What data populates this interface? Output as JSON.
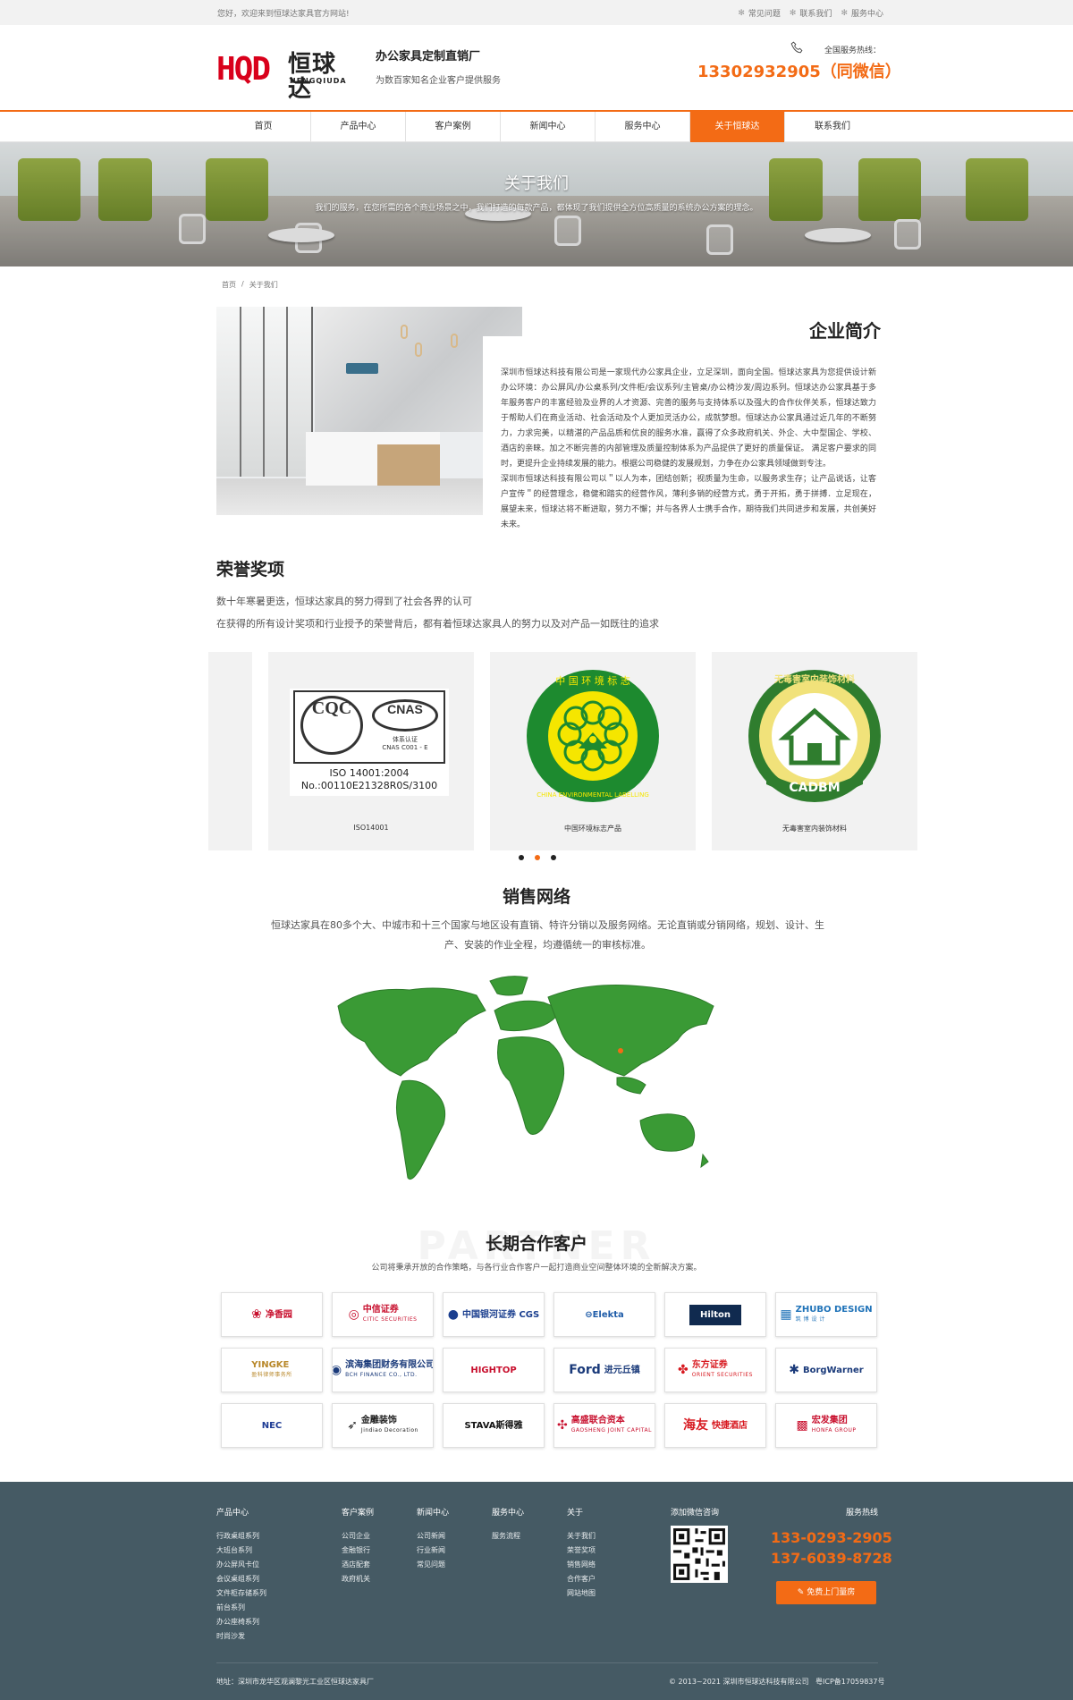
{
  "topbar": {
    "welcome": "您好，欢迎来到恒球达家具官方网站!",
    "links": [
      "常见问题",
      "联系我们",
      "服务中心"
    ]
  },
  "header": {
    "logo_text": "HQD",
    "logo_cn": "恒球达",
    "logo_en": "HENGQIUDA",
    "slogan_title": "办公家具定制直销厂",
    "slogan_sub": "为数百家知名企业客户提供服务",
    "hotline_label": "全国服务热线：",
    "hotline_number": "13302932905（同微信）"
  },
  "nav": {
    "items": [
      "首页",
      "产品中心",
      "客户案例",
      "新闻中心",
      "服务中心",
      "关于恒球达",
      "联系我们"
    ],
    "active": "关于恒球达"
  },
  "banner": {
    "title": "关于我们",
    "subtitle": "我们的服务，在您所需的各个商业场景之中，我们打造的每款产品，都体现了我们提供全方位高质量的系统办公方案的理念。"
  },
  "breadcrumb": {
    "home": "首页",
    "sep": "/",
    "current": "关于我们"
  },
  "intro": {
    "title": "企业简介",
    "p1": "深圳市恒球达科技有限公司是一家现代办公家具企业，立足深圳，面向全国。恒球达家具为您提供设计新办公环境：办公屏风/办公桌系列/文件柜/会议系列/主管桌/办公椅沙发/周边系列。恒球达办公家具基于多年服务客户的丰富经验及业界的人才资源、完善的服务与支持体系以及强大的合作伙伴关系，恒球达致力于帮助人们在商业活动、社会活动及个人更加灵活办公，成就梦想。恒球达办公家具通过近几年的不断努力，力求完美，以精湛的产品品质和优良的服务水准，赢得了众多政府机关、外企、大中型国企、学校、酒店的亲睐。加之不断完善的内部管理及质量控制体系为产品提供了更好的质量保证。 满足客户要求的同时，更提升企业持续发展的能力。根据公司稳健的发展规划，力争在办公家具领域做到专注。",
    "p2": "深圳市恒球达科技有限公司以＂以人为本，团结创新；视质量为生命，以服务求生存；让产品说话，让客户宣传＂的经营理念，稳健和踏实的经营作风，薄利多销的经营方式，勇于开拓，勇于拼搏．立足现在，展望未来，恒球达将不断进取，努力不懈；并与各界人士携手合作，期待我们共同进步和发展，共创美好未来。"
  },
  "honors": {
    "title": "荣誉奖项",
    "desc1": "数十年寒暑更迭，恒球达家具的努力得到了社会各界的认可",
    "desc2": "在获得的所有设计奖项和行业授予的荣誉背后，都有着恒球达家具人的努力以及对产品一如既往的追求",
    "cards": [
      {
        "caption": "ISO14001",
        "cert_logo1": "CQC",
        "cert_logo2": "CNAS",
        "cert_line1": "体系认证",
        "cert_line2": "CNAS  C001 - E",
        "iso_line1": "ISO 14001:2004",
        "iso_line2": "No.:00110E21328R0S/3100"
      },
      {
        "caption": "中国环境标志产品",
        "seal_top": "中 国 环 境 标 志",
        "seal_bottom": "CHINA ENVIRONMENTAL LABELLING",
        "seal_color": "#1d8a2f"
      },
      {
        "caption": "无毒害室内装饰材料",
        "seal_top": "无毒害室内装饰材料",
        "seal_bottom": "CADBM",
        "seal_color": "#2f7d2e"
      }
    ],
    "active_dot": 1
  },
  "sales": {
    "title": "销售网络",
    "desc": "恒球达家具在80多个大、中城市和十三个国家与地区设有直销、特许分销以及服务网络。无论直销或分销网络，规划、设计、生产、安装的作业全程，均遵循统一的审核标准。",
    "map_color": "#3a9a35"
  },
  "partners": {
    "bg_text": "PARTNER",
    "title": "长期合作客户",
    "desc": "公司将秉承开放的合作策略，与各行业合作客户一起打造商业空间整体环境的全新解决方案。",
    "clients": [
      {
        "mark": "❀",
        "name": "净香园",
        "sub": "",
        "color": "#c8102e",
        "icon": "lotus-icon"
      },
      {
        "mark": "◎",
        "name": "中信证券",
        "sub": "CITIC SECURITIES",
        "color": "#c8102e",
        "icon": "citic-icon"
      },
      {
        "mark": "●",
        "name": "中国银河证券 CGS",
        "sub": "",
        "color": "#1b3f8f",
        "icon": "galaxy-icon"
      },
      {
        "mark": "",
        "name": "⊖Elekta",
        "sub": "",
        "color": "#1f5ca8",
        "icon": "elekta-icon"
      },
      {
        "mark": "",
        "name": "Hilton",
        "sub": "",
        "color": "#ffffff",
        "icon": "hilton-icon",
        "bg": "#102a4f"
      },
      {
        "mark": "▦",
        "name": "ZHUBO DESIGN",
        "sub": "筑 博 设 计",
        "color": "#1e72b8",
        "icon": "zhubo-icon"
      },
      {
        "mark": "",
        "name": "YINGKE",
        "sub": "盈科律师事务所",
        "color": "#b9892c",
        "icon": "yingke-icon"
      },
      {
        "mark": "◉",
        "name": "滨海集团财务有限公司",
        "sub": "BCH FINANCE CO., LTD.",
        "color": "#1a3a7a",
        "icon": "bch-icon"
      },
      {
        "mark": "",
        "name": "HIGHTOP",
        "sub": "",
        "color": "#c8102e",
        "icon": "hightop-icon"
      },
      {
        "mark": "Ford",
        "name": "进元丘镇",
        "sub": "",
        "color": "#1a3a7a",
        "icon": "ford-icon"
      },
      {
        "mark": "✤",
        "name": "东方证券",
        "sub": "ORIENT SECURITIES",
        "color": "#d71920",
        "icon": "orient-icon"
      },
      {
        "mark": "✱",
        "name": "BorgWarner",
        "sub": "",
        "color": "#1a3a7a",
        "icon": "borgwarner-icon"
      },
      {
        "mark": "",
        "name": "NEC",
        "sub": "",
        "color": "#1d3b94",
        "icon": "nec-icon"
      },
      {
        "mark": "➶",
        "name": "金雕装饰",
        "sub": "Jindiao Decoration",
        "color": "#222222",
        "icon": "jindiao-icon"
      },
      {
        "mark": "",
        "name": "STAVA斯得雅",
        "sub": "",
        "color": "#111111",
        "icon": "stava-icon"
      },
      {
        "mark": "✣",
        "name": "高盛联合资本",
        "sub": "GAOSHENG JOINT CAPITAL",
        "color": "#c8102e",
        "icon": "gaosheng-icon"
      },
      {
        "mark": "海友",
        "name": "快捷酒店",
        "sub": "",
        "color": "#d71920",
        "icon": "haiyou-icon"
      },
      {
        "mark": "▩",
        "name": "宏发集团",
        "sub": "HONFA GROUP",
        "color": "#c8102e",
        "icon": "honfa-icon"
      }
    ]
  },
  "footer": {
    "cols": [
      {
        "title": "产品中心",
        "items": [
          "行政桌组系列",
          "大班台系列",
          "办公屏风卡位",
          "会议桌组系列",
          "文件柜存储系列",
          "前台系列",
          "办公座椅系列",
          "时尚沙发"
        ]
      },
      {
        "title": "客户案例",
        "items": [
          "公司企业",
          "金融银行",
          "酒店配套",
          "政府机关"
        ]
      },
      {
        "title": "新闻中心",
        "items": [
          "公司新闻",
          "行业新闻",
          "常见问题"
        ]
      },
      {
        "title": "服务中心",
        "items": [
          "服务流程"
        ]
      },
      {
        "title": "关于",
        "items": [
          "关于我们",
          "荣誉奖项",
          "销售网络",
          "合作客户",
          "网站地图"
        ]
      }
    ],
    "wechat_label": "添加微信咨询",
    "hotline_label": "服务热线",
    "phone1": "133-0293-2905",
    "phone2": "137-6039-8728",
    "visit_button": "免费上门量房",
    "address": "地址：深圳市龙华区观澜黎光工业区恒球达家具厂",
    "copyright": "© 2013~2021 深圳市恒球达科技有限公司",
    "icp": "粤ICP备17059837号"
  },
  "colors": {
    "accent": "#f36b15",
    "brand_red": "#d9001b",
    "footer_bg": "#455a64"
  }
}
